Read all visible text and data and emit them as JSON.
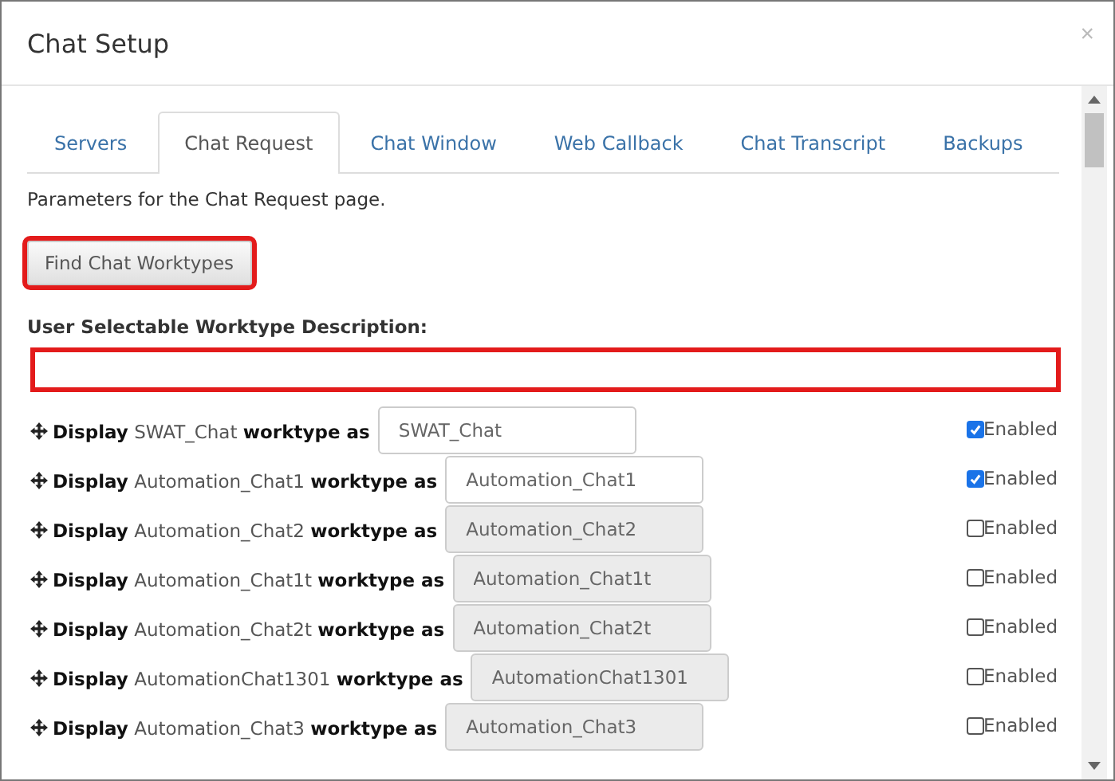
{
  "dialog": {
    "title": "Chat Setup",
    "close": "×"
  },
  "tabs": [
    {
      "label": "Servers",
      "selected": false
    },
    {
      "label": "Chat Request",
      "selected": true
    },
    {
      "label": "Chat Window",
      "selected": false
    },
    {
      "label": "Web Callback",
      "selected": false
    },
    {
      "label": "Chat Transcript",
      "selected": false
    },
    {
      "label": "Backups",
      "selected": false
    }
  ],
  "intro": "Parameters for the Chat Request page.",
  "find_button": {
    "label": "Find Chat Worktypes",
    "highlighted": true
  },
  "description_field": {
    "label": "User Selectable Worktype Description:",
    "highlighted": true
  },
  "worktypes": [
    {
      "text": "**Display** SWAT_Chat **worktype as**",
      "value": "SWAT_Chat",
      "checked": true,
      "checkbox_label": "Enabled"
    },
    {
      "text": "**Display** Automation_Chat1 **worktype as**",
      "value": "Automation_Chat1",
      "checked": true,
      "checkbox_label": "Enabled"
    },
    {
      "text": "**Display** Automation_Chat2 **worktype as**",
      "value": "Automation_Chat2",
      "checked": false,
      "checkbox_label": "Enabled"
    },
    {
      "text": "**Display** Automation_Chat1t **worktype as**",
      "value": "Automation_Chat1t",
      "checked": false,
      "checkbox_label": "Enabled"
    },
    {
      "text": "**Display** Automation_Chat2t **worktype as**",
      "value": "Automation_Chat2t",
      "checked": false,
      "checkbox_label": "Enabled"
    },
    {
      "text": "**Display** AutomationChat1301 **worktype as**",
      "value": "AutomationChat1301",
      "checked": false,
      "checkbox_label": "Enabled"
    },
    {
      "text": "**Display** Automation_Chat3 **worktype as**",
      "value": "Automation_Chat3",
      "checked": false,
      "checkbox_label": "Enabled"
    }
  ]
}
